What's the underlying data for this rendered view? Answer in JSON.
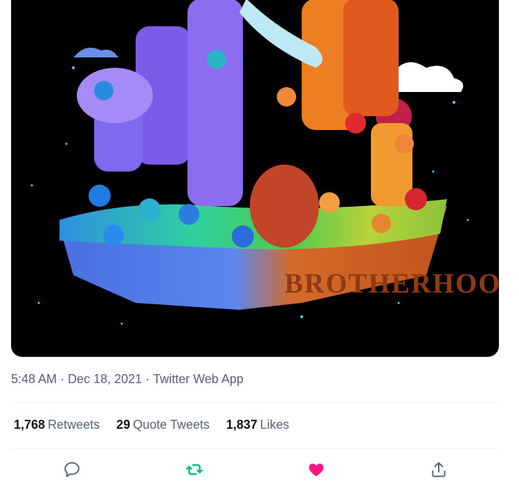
{
  "tweet": {
    "meta": {
      "time": "5:48 AM",
      "date": "Dec 18, 2021",
      "source": "Twitter Web App",
      "separator": "·"
    },
    "stats": {
      "retweets_count": "1,768",
      "retweets_label": "Retweets",
      "quotes_count": "29",
      "quotes_label": "Quote Tweets",
      "likes_count": "1,837",
      "likes_label": "Likes"
    },
    "image_text": "BROTHERHOOD",
    "actions": [
      {
        "icon": "reply-icon",
        "color": "#536471"
      },
      {
        "icon": "retweet-icon",
        "color": "#00ba7c"
      },
      {
        "icon": "heart-icon",
        "color": "#f91880"
      },
      {
        "icon": "share-icon",
        "color": "#536471"
      }
    ]
  }
}
